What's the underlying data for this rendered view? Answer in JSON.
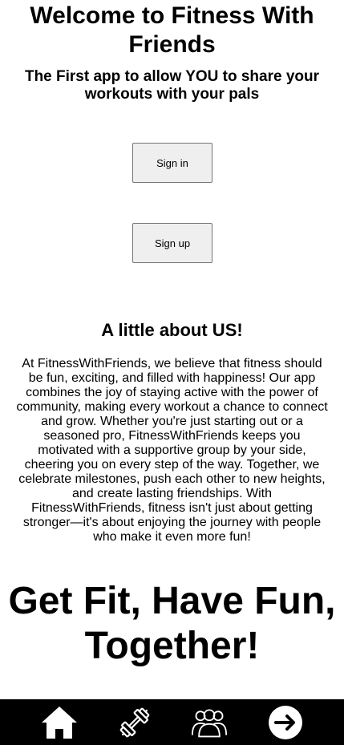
{
  "header": {
    "title": "Welcome to Fitness With Friends",
    "subtitle": "The First app to allow YOU to share your workouts with your pals"
  },
  "auth": {
    "signin_label": "Sign in",
    "signup_label": "Sign up"
  },
  "about": {
    "heading": "A little about US!",
    "body": "At FitnessWithFriends, we believe that fitness should be fun, exciting, and filled with happiness! Our app combines the joy of staying active with the power of community, making every workout a chance to connect and grow. Whether you're just starting out or a seasoned pro, FitnessWithFriends keeps you motivated with a supportive group by your side, cheering you on every step of the way. Together, we celebrate milestones, push each other to new heights, and create lasting friendships. With FitnessWithFriends, fitness isn't just about getting stronger—it's about enjoying the journey with people who make it even more fun!"
  },
  "tagline": "Get Fit, Have Fun, Together!",
  "nav": {
    "items": [
      {
        "icon": "home-icon"
      },
      {
        "icon": "dumbbell-icon"
      },
      {
        "icon": "friends-icon"
      },
      {
        "icon": "arrow-right-circle-icon"
      }
    ],
    "background": "#000000",
    "icon_color": "#ffffff"
  }
}
